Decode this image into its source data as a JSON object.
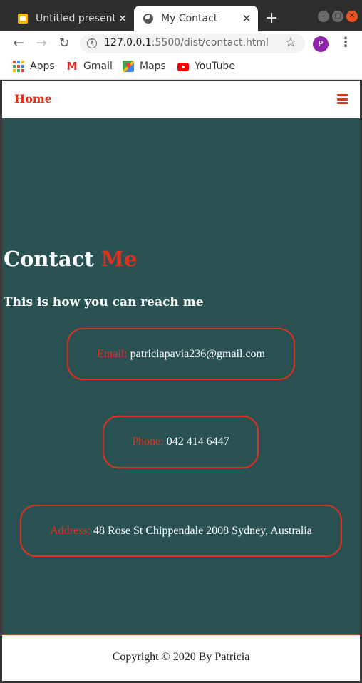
{
  "browser": {
    "tabs": [
      {
        "title": "Untitled presentation",
        "icon": "slides-icon",
        "active": false
      },
      {
        "title": "My Contact",
        "icon": "globe-icon",
        "active": true
      }
    ],
    "close_glyph": "✕",
    "new_tab_glyph": "+",
    "url_host": "127.0.0.1",
    "url_path": ":5500/dist/contact.html",
    "profile_initial": "P",
    "bookmarks": [
      {
        "label": "Apps",
        "icon": "apps-grid-icon"
      },
      {
        "label": "Gmail",
        "icon": "gmail-icon"
      },
      {
        "label": "Maps",
        "icon": "maps-icon"
      },
      {
        "label": "YouTube",
        "icon": "youtube-icon"
      }
    ]
  },
  "site": {
    "nav": {
      "home": "Home"
    },
    "heading": {
      "main": "Contact",
      "accent": "Me"
    },
    "subheading": "This is how you can reach me",
    "contacts": [
      {
        "label": "Email:",
        "value": "patriciapavia236@gmail.com"
      },
      {
        "label": "Phone:",
        "value": "042 414 6447"
      },
      {
        "label": "Address:",
        "value": "48 Rose St Chippendale 2008 Sydney, Australia"
      }
    ],
    "footer": "Copyright © 2020 By Patricia"
  },
  "colors": {
    "accent": "#e0301e",
    "page_background": "#2b5252",
    "text_light": "#ffffff"
  }
}
